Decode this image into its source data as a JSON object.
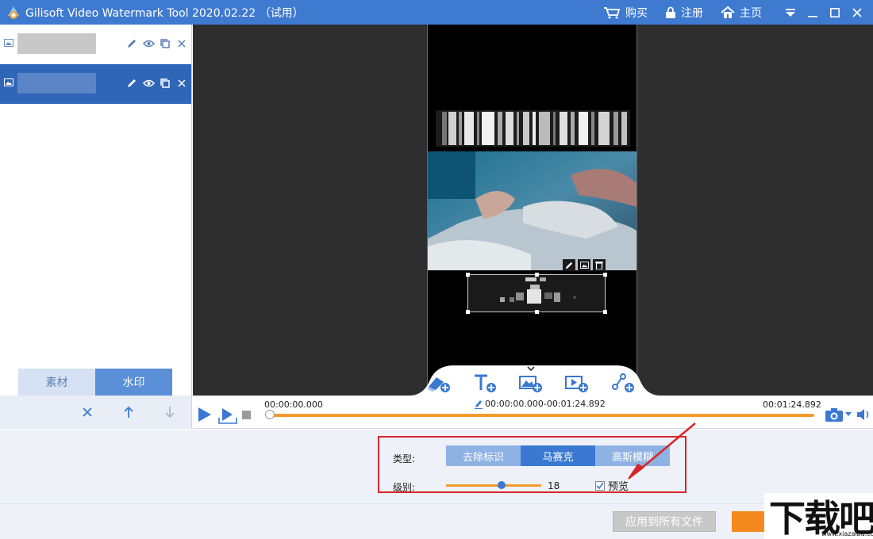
{
  "titlebar": {
    "title": "Gilisoft Video Watermark Tool 2020.02.22 （试用）",
    "buy": "购买",
    "register": "注册",
    "home": "主页"
  },
  "sidebar": {
    "tabs": [
      {
        "label": "素材",
        "active": false
      },
      {
        "label": "水印",
        "active": true
      }
    ]
  },
  "timeline": {
    "start_time": "00:00:00.000",
    "range": "00:00:00.000-00:01:24.892",
    "end_time": "00:01:24.892",
    "progress": 0
  },
  "settings": {
    "type_label": "类型:",
    "type_options": [
      {
        "label": "去除标识",
        "selected": false
      },
      {
        "label": "马赛克",
        "selected": true
      },
      {
        "label": "高斯模糊",
        "selected": false
      }
    ],
    "level_label": "级别:",
    "level_value": "18",
    "level_fraction": 0.58,
    "preview_label": "预览",
    "preview_checked": true
  },
  "footer": {
    "apply_all": "应用到所有文件"
  },
  "branding": {
    "site_logo": "下载吧",
    "site_url": "www.xiazaiba.com"
  },
  "colors": {
    "accent": "#3f7ad1",
    "selected_row": "#2f66b8",
    "track": "#f39a2c",
    "highlight_box": "#d8262c"
  }
}
